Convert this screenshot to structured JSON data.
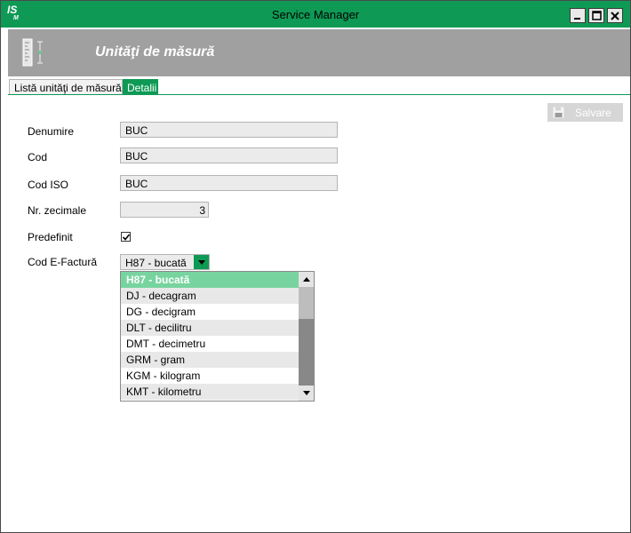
{
  "window": {
    "title": "Service Manager",
    "logo_text": "IS",
    "logo_sub": "M"
  },
  "header": {
    "title": "Unităţi de măsură",
    "icon": "ruler-icon"
  },
  "tabs": [
    {
      "label": "Listă unităţi de măsură",
      "active": false
    },
    {
      "label": "Detalii",
      "active": true
    }
  ],
  "toolbar": {
    "save_label": "Salvare",
    "save_icon": "save-icon"
  },
  "form": {
    "denumire": {
      "label": "Denumire",
      "value": "BUC"
    },
    "cod": {
      "label": "Cod",
      "value": "BUC"
    },
    "cod_iso": {
      "label": "Cod ISO",
      "value": "BUC"
    },
    "zecimale": {
      "label": "Nr. zecimale",
      "value": "3"
    },
    "predefinit": {
      "label": "Predefinit",
      "checked": true
    },
    "efactura": {
      "label": "Cod E-Factură",
      "value": "H87 - bucată",
      "options": [
        "H87 - bucată",
        "DJ - decagram",
        "DG - decigram",
        "DLT - decilitru",
        "DMT - decimetru",
        "GRM - gram",
        "KGM - kilogram",
        "KMT - kilometru"
      ],
      "selected_index": 0
    }
  },
  "colors": {
    "accent": "#0e9a55",
    "header_band": "#a0a0a0",
    "selected_item": "#77d49f"
  }
}
